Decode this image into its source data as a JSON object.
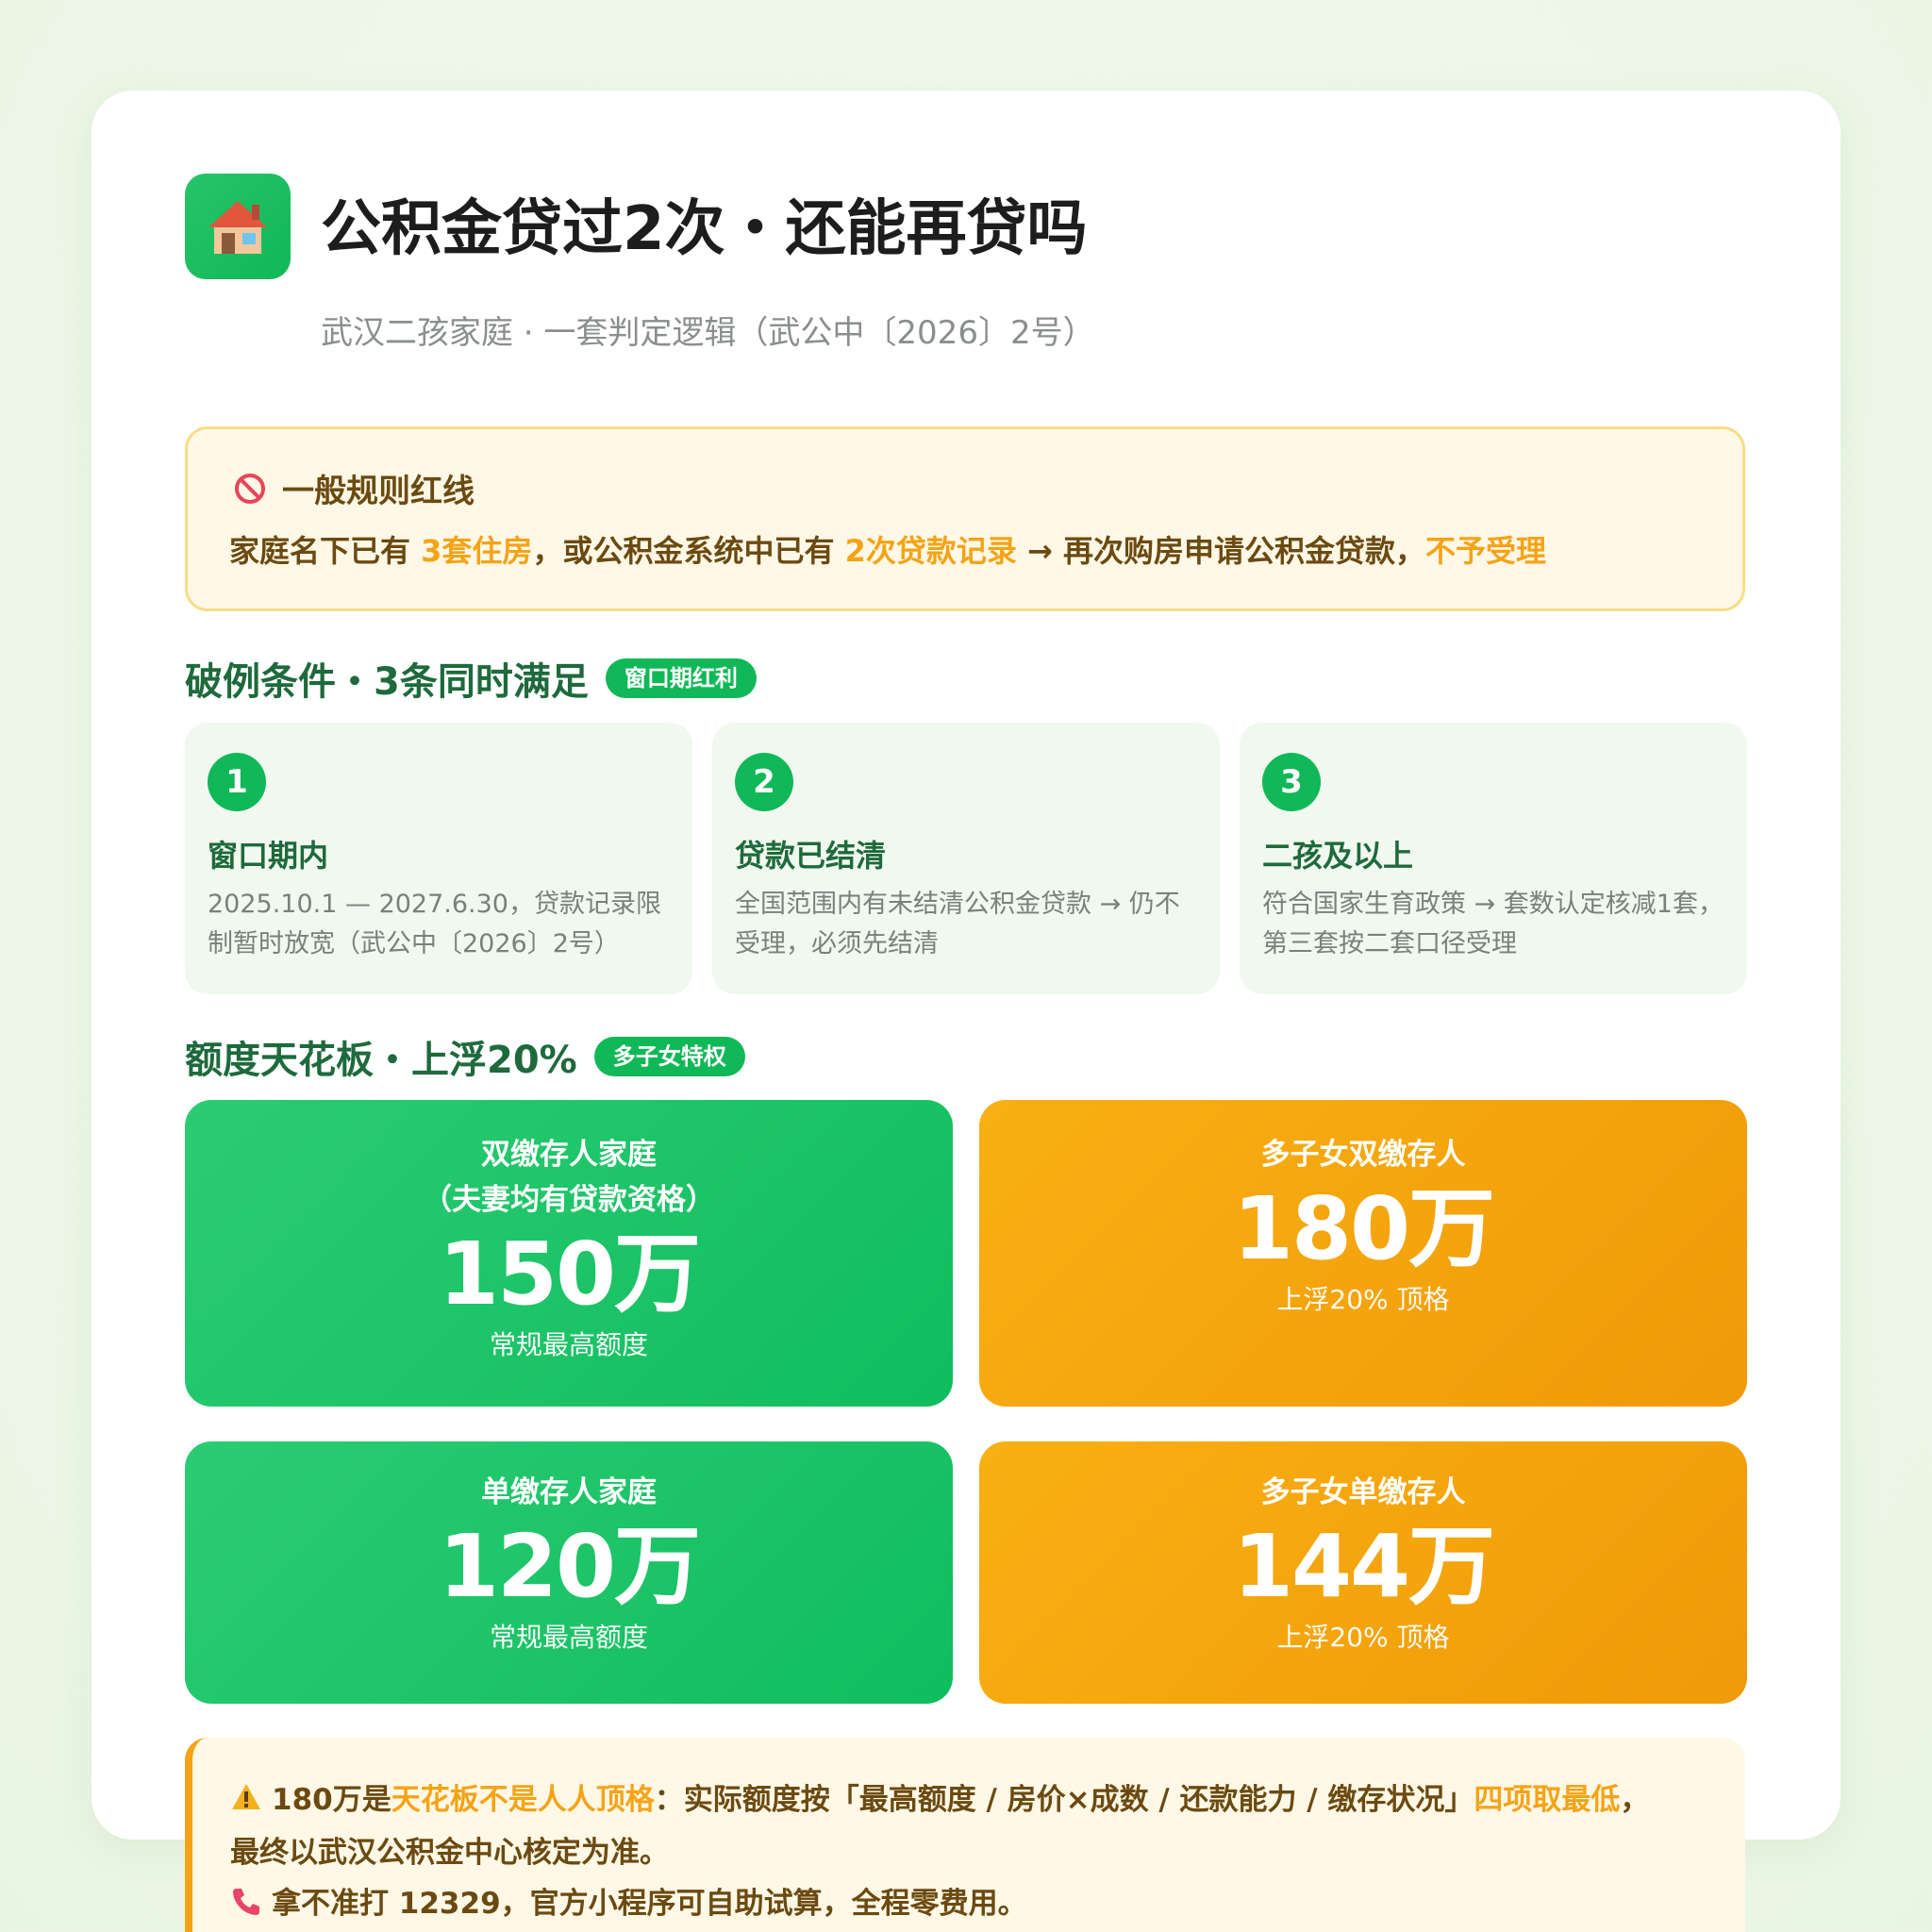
{
  "header": {
    "icon": "house-icon",
    "title": "公积金贷过2次・还能再贷吗",
    "subtitle": "武汉二孩家庭 · 一套判定逻辑（武公中〔2026〕2号）"
  },
  "redline": {
    "icon": "no-entry-icon",
    "heading": "一般规则红线",
    "parts": [
      "家庭名下已有 ",
      "3套住房",
      "，或公积金系统中已有 ",
      "2次贷款记录",
      " → 再次购房申请公积金贷款，",
      "不予受理"
    ]
  },
  "conditions": {
    "title": "破例条件・3条同时满足",
    "badge": "窗口期红利",
    "items": [
      {
        "num": "1",
        "title": "窗口期内",
        "desc": "2025.10.1 — 2027.6.30，贷款记录限制暂时放宽（武公中〔2026〕2号）"
      },
      {
        "num": "2",
        "title": "贷款已结清",
        "desc": "全国范围内有未结清公积金贷款 → 仍不受理，必须先结清"
      },
      {
        "num": "3",
        "title": "二孩及以上",
        "desc": "符合国家生育政策 → 套数认定核减1套，第三套按二套口径受理"
      }
    ]
  },
  "quota": {
    "title": "额度天花板・上浮20%",
    "badge": "多子女特权",
    "tiles": [
      {
        "label": "双缴存人家庭",
        "label2": "（夫妻均有贷款资格）",
        "value": "150万",
        "note": "常规最高额度"
      },
      {
        "label": "多子女双缴存人",
        "value": "180万",
        "note": "上浮20% 顶格"
      },
      {
        "label": "单缴存人家庭",
        "value": "120万",
        "note": "常规最高额度"
      },
      {
        "label": "多子女单缴存人",
        "value": "144万",
        "note": "上浮20% 顶格"
      }
    ]
  },
  "note": {
    "warning_icon": "warning-icon",
    "line1_parts": [
      "180万是",
      "天花板不是人人顶格",
      "：实际额度按「最高额度 / 房价×成数 / 还款能力 / 缴存状况」",
      "四项取最低",
      "，"
    ],
    "line2": "最终以武汉公积金中心核定为准。",
    "phone_icon": "phone-icon",
    "line3": "拿不准打 12329，官方小程序可自助试算，全程零费用。"
  },
  "colors": {
    "green": "#10b857",
    "orange": "#f5a316",
    "dark_green": "#1e6a3c",
    "brown": "#6b4a12"
  }
}
